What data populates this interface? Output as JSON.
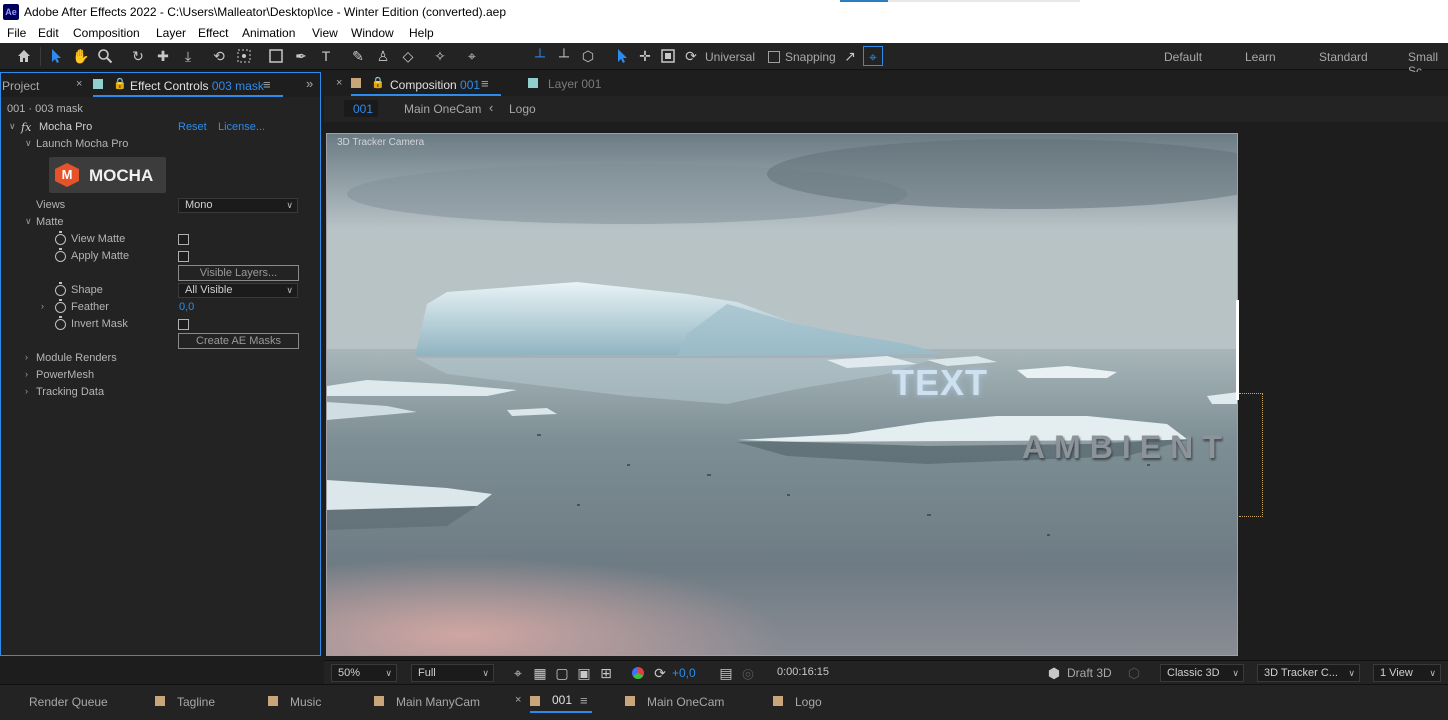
{
  "window": {
    "app_icon": "Ae",
    "title": "Adobe After Effects 2022 - C:\\Users\\Malleator\\Desktop\\Ice - Winter Edition (converted).aep"
  },
  "menu": [
    "File",
    "Edit",
    "Composition",
    "Layer",
    "Effect",
    "Animation",
    "View",
    "Window",
    "Help"
  ],
  "toolbar": {
    "tools": [
      "home-icon",
      "selection-tool-icon",
      "hand-tool-icon",
      "zoom-tool-icon",
      "orbit-camera-icon",
      "pan-camera-icon",
      "dolly-camera-icon",
      "rotate-tool-icon",
      "pan-behind-icon",
      "rectangle-tool-icon",
      "pen-tool-icon",
      "type-tool-icon",
      "brush-tool-icon",
      "clone-stamp-icon",
      "eraser-tool-icon",
      "roto-brush-icon",
      "puppet-pin-icon"
    ],
    "axis_mode": "Universal",
    "snapping_label": "Snapping",
    "workspaces": [
      "Default",
      "Learn",
      "Standard",
      "Small Sc"
    ]
  },
  "left_panel": {
    "tab_project": "Project",
    "tab_effect_controls_prefix": "Effect Controls",
    "tab_effect_controls_layer": "003 mask",
    "subtitle": "001 · 003 mask",
    "effect": {
      "fx_glyph": "fx",
      "name": "Mocha Pro",
      "reset": "Reset",
      "license": "License...",
      "launch": "Launch Mocha Pro",
      "logo_text": "MOCHA",
      "views_label": "Views",
      "views_value": "Mono",
      "matte_label": "Matte",
      "view_matte": "View Matte",
      "apply_matte": "Apply Matte",
      "visible_layers_btn": "Visible Layers...",
      "shape_label": "Shape",
      "shape_value": "All Visible",
      "feather_label": "Feather",
      "feather_value": "0,0",
      "invert_mask": "Invert Mask",
      "create_masks_btn": "Create AE Masks",
      "module_renders": "Module Renders",
      "powermesh": "PowerMesh",
      "tracking_data": "Tracking Data"
    }
  },
  "comp_panel": {
    "tab_comp_prefix": "Composition",
    "tab_comp_name": "001",
    "tab_layer": "Layer 001",
    "breadcrumbs": [
      "001",
      "Main OneCam",
      "Logo"
    ],
    "camera_label": "3D Tracker Camera",
    "overlay_text_1": "TEXT",
    "overlay_text_2": "AMBIENT",
    "footer": {
      "zoom": "50%",
      "resolution": "Full",
      "exposure": "+0,0",
      "timecode": "0:00:16:15",
      "renderer_draft": "Draft 3D",
      "renderer": "Classic 3D",
      "camera": "3D Tracker C...",
      "views": "1 View"
    }
  },
  "timeline_tabs": [
    {
      "label": "Render Queue",
      "color": ""
    },
    {
      "label": "Tagline",
      "color": "#c8a67a"
    },
    {
      "label": "Music",
      "color": "#c8a67a"
    },
    {
      "label": "Main ManyCam",
      "color": "#c8a67a"
    },
    {
      "label": "001",
      "color": "#c8a67a",
      "active": true
    },
    {
      "label": "Main OneCam",
      "color": "#c8a67a"
    },
    {
      "label": "Logo",
      "color": "#c8a67a"
    }
  ],
  "colors": {
    "accent": "#2d8ceb",
    "panel": "#232323",
    "label_swatch": "#c8a67a",
    "layer_swatch": "#8fd0cf"
  }
}
